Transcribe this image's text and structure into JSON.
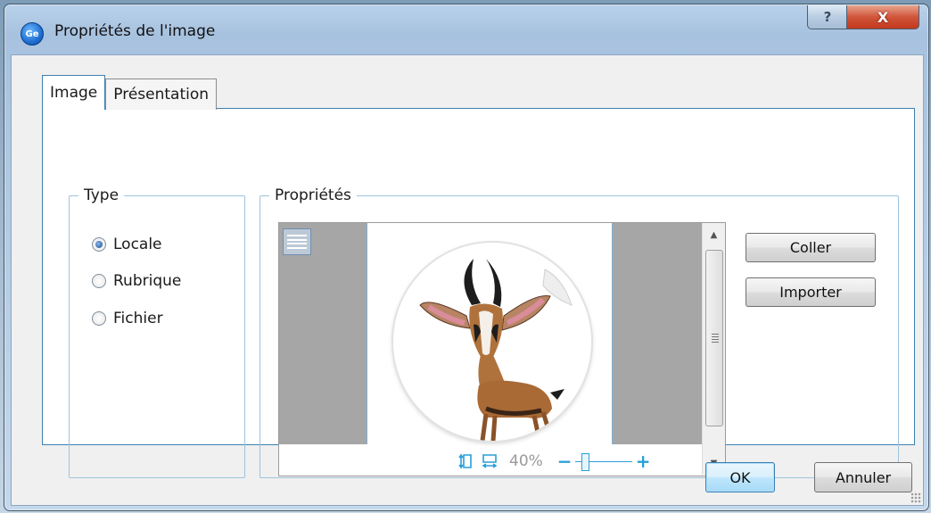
{
  "window": {
    "app_icon_text": "Ge",
    "title": "Propriétés de l'image",
    "help_symbol": "?",
    "close_symbol": "X"
  },
  "tabs": [
    {
      "label": "Image",
      "active": true
    },
    {
      "label": "Présentation",
      "active": false
    }
  ],
  "type_group": {
    "legend": "Type",
    "options": [
      {
        "label": "Locale",
        "checked": true
      },
      {
        "label": "Rubrique",
        "checked": false
      },
      {
        "label": "Fichier",
        "checked": false
      }
    ]
  },
  "props_group": {
    "legend": "Propriétés",
    "zoom_percent": "40%",
    "zoom_minus": "−",
    "zoom_plus": "+",
    "paste_label": "Coller",
    "import_label": "Importer"
  },
  "footer": {
    "ok_label": "OK",
    "cancel_label": "Annuler"
  },
  "colors": {
    "accent": "#3c7fb1",
    "zoom_blue": "#2a9fd8",
    "close_red": "#c2381c"
  }
}
